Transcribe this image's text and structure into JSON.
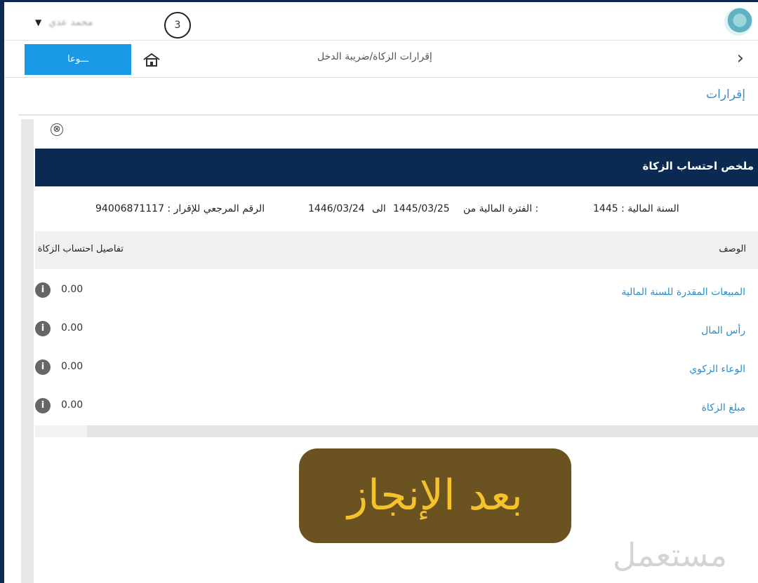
{
  "user": {
    "name": "محمد عدي",
    "avatar_glyph": "3"
  },
  "colors": {
    "header_bg": "#0b2a52",
    "accent_blue": "#1a9ae6",
    "link_blue": "#2a8ec9",
    "badge_bg": "#6b5221",
    "badge_text": "#f4c22a"
  },
  "breadcrumb": {
    "action_button_label": "ـــوعا",
    "title": "إقرارات الزكاة/ضريبة الدخل",
    "back_icon": "chevron-right-icon"
  },
  "page": {
    "title": "إقرارات"
  },
  "modal": {
    "close_glyph": "⊗",
    "title": "ملخص احتساب الزكاة",
    "fiscal_year_label": "السنة المالية : 1445",
    "period_label": "الفترة المالية من :",
    "period_from": "1445/03/25",
    "period_to_label": "الى",
    "period_to": "1446/03/24",
    "reference_label": "الرقم المرجعي للإقرار : 94006871117",
    "table": {
      "col_description": "الوصف",
      "col_details": "تفاصيل احتساب الزكاة",
      "rows": [
        {
          "label": "المبيعات المقدرة للسنة المالية",
          "value": "0.00"
        },
        {
          "label": "رأس المال",
          "value": "0.00"
        },
        {
          "label": "الوعاء الزكوي",
          "value": "0.00"
        },
        {
          "label": "مبلغ الزكاة",
          "value": "0.00"
        }
      ]
    }
  },
  "overlay": {
    "badge_text": "بعد الإنجاز",
    "watermark": "مستعمل"
  }
}
